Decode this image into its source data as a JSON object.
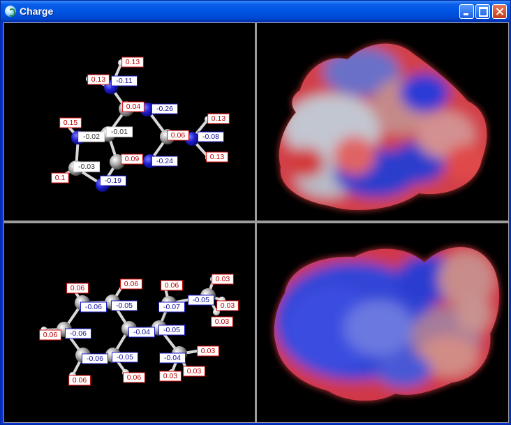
{
  "window": {
    "title": "Charge",
    "app_icon": "molecule-app-icon",
    "buttons": [
      "minimize",
      "maximize",
      "close"
    ],
    "frame_color": "#0831d9",
    "viewport_background": "#000000"
  },
  "top_molecule": {
    "charges": [
      "0.13",
      "0.13",
      "-0.11",
      "0.04",
      "-0.26",
      "0.13",
      "0.15",
      "-0.02",
      "-0.01",
      "0.06",
      "-0.08",
      "0.09",
      "-0.03",
      "-0.24",
      "0.13",
      "0.1",
      "-0.19"
    ]
  },
  "bottom_molecule": {
    "charges": [
      "0.06",
      "0.06",
      "0.06",
      "0.03",
      "-0.06",
      "-0.05",
      "-0.05",
      "0.03",
      "-0.07",
      "0.03",
      "0.06",
      "-0.06",
      "-0.04",
      "-0.05",
      "0.03",
      "-0.06",
      "-0.05",
      "-0.04",
      "0.03",
      "0.06",
      "0.06",
      "0.03"
    ]
  },
  "surface_colors": {
    "positive": "#e03030",
    "negative": "#2a3cd8",
    "neutral": "#c0c4cc"
  }
}
